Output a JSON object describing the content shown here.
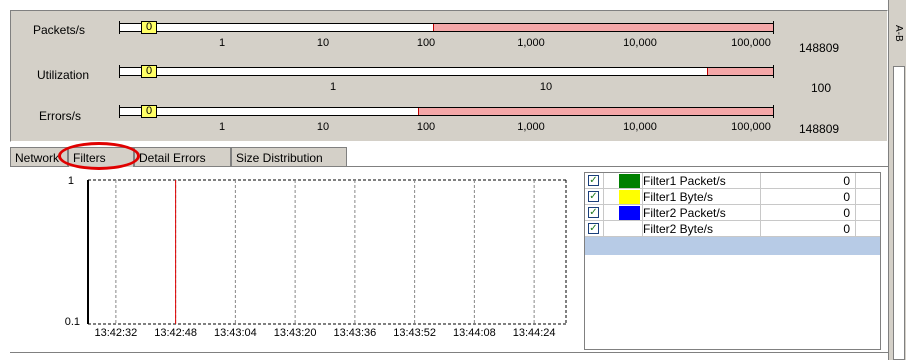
{
  "gauges": [
    {
      "label": "Packets/s",
      "value": "0",
      "max": "148809",
      "ticks": [
        "1",
        "10",
        "100",
        "1,000",
        "10,000",
        "100,000"
      ],
      "fill_start_fraction": 0.49
    },
    {
      "label": "Utilization",
      "value": "0",
      "max": "100",
      "ticks": [
        "1",
        "10"
      ],
      "fill_start_fraction": 0.89
    },
    {
      "label": "Errors/s",
      "value": "0",
      "max": "148809",
      "ticks": [
        "1",
        "10",
        "100",
        "1,000",
        "10,000",
        "100,000"
      ],
      "fill_start_fraction": 0.465
    }
  ],
  "tabs": [
    "Network",
    "Filters",
    "Detail Errors",
    "Size Distribution"
  ],
  "active_tab": "Filters",
  "side_tab_label": "A-B",
  "chart_data": {
    "type": "line",
    "y_top_label": "1",
    "y_bottom_label": "0.1",
    "x_labels": [
      "13:42:32",
      "13:42:48",
      "13:43:04",
      "13:43:20",
      "13:43:36",
      "13:43:52",
      "13:44:08",
      "13:44:24"
    ],
    "cursor_time": "13:42:48",
    "cursor_color": "#e00000",
    "grid": true
  },
  "filters": [
    {
      "checked": true,
      "color": "#008000",
      "name": "Filter1 Packet/s",
      "value": "0"
    },
    {
      "checked": true,
      "color": "#ffff00",
      "name": "Filter1 Byte/s",
      "value": "0"
    },
    {
      "checked": true,
      "color": "#0000ff",
      "name": "Filter2 Packet/s",
      "value": "0"
    },
    {
      "checked": true,
      "color": "#ffffff",
      "name": "Filter2 Byte/s",
      "value": "0"
    }
  ],
  "colors": {
    "gauge_fill": "#f4a7a8",
    "value_box": "#ffff66",
    "annotation": "#e00000",
    "selection": "#b7cbe6"
  }
}
